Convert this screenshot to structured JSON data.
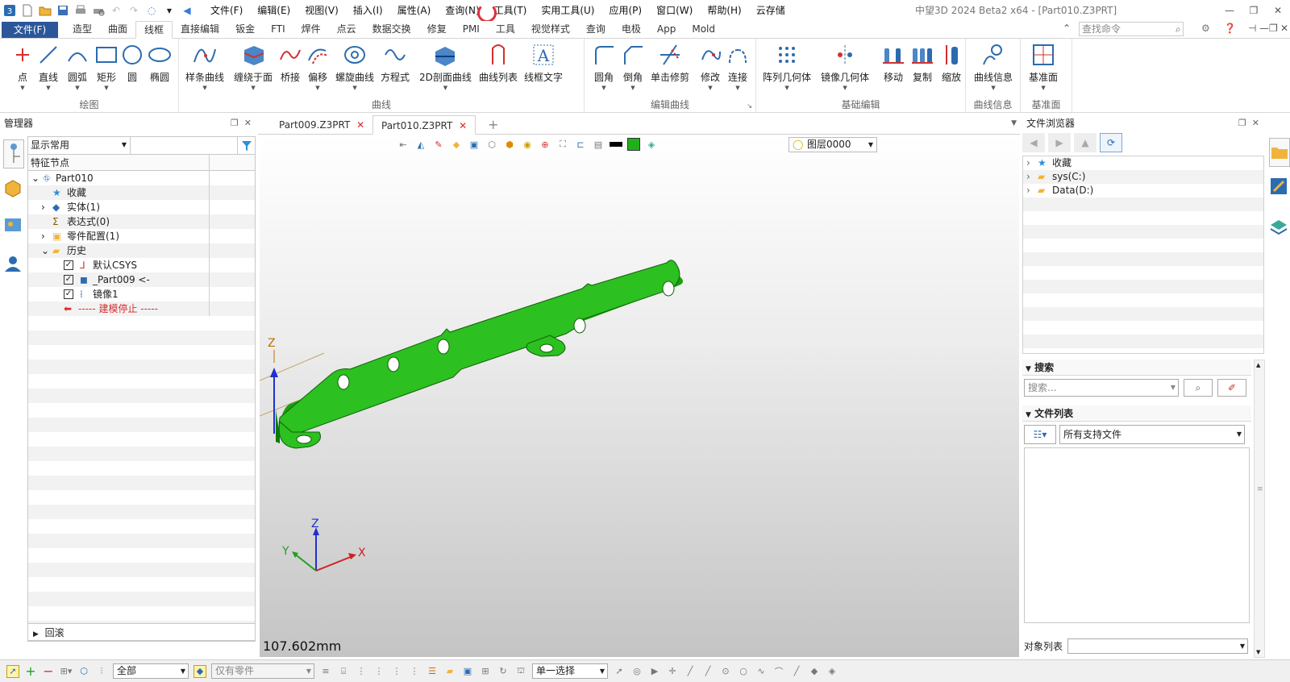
{
  "menubar": {
    "items": [
      "文件(F)",
      "编辑(E)",
      "视图(V)",
      "插入(I)",
      "属性(A)",
      "查询(N)",
      "工具(T)",
      "实用工具(U)",
      "应用(P)",
      "窗口(W)",
      "帮助(H)",
      "云存储"
    ]
  },
  "window": {
    "title": "中望3D 2024 Beta2 x64 - [Part010.Z3PRT]"
  },
  "ribbon_tabs": {
    "file": "文件(F)",
    "tabs": [
      "造型",
      "曲面",
      "线框",
      "直接编辑",
      "钣金",
      "FTI",
      "焊件",
      "点云",
      "数据交换",
      "修复",
      "PMI",
      "工具",
      "视觉样式",
      "查询",
      "电极",
      "App",
      "Mold"
    ],
    "active": "线框"
  },
  "command_search": {
    "placeholder": "查找命令"
  },
  "ribbon": {
    "groups": [
      {
        "title": "绘图",
        "buttons": [
          "点",
          "直线",
          "圆弧",
          "矩形",
          "圆",
          "椭圆"
        ]
      },
      {
        "title": "曲线",
        "buttons": [
          "样条曲线",
          "缠绕于面",
          "桥接",
          "偏移",
          "螺旋曲线",
          "方程式",
          "2D剖面曲线",
          "曲线列表",
          "线框文字"
        ]
      },
      {
        "title": "编辑曲线",
        "buttons": [
          "圆角",
          "倒角",
          "单击修剪",
          "修改",
          "连接"
        ]
      },
      {
        "title": "基础编辑",
        "buttons": [
          "阵列几何体",
          "镜像几何体",
          "移动",
          "复制",
          "缩放"
        ]
      },
      {
        "title": "曲线信息",
        "buttons": [
          "曲线信息"
        ]
      },
      {
        "title": "基准面",
        "buttons": [
          "基准面"
        ]
      }
    ]
  },
  "manager": {
    "title": "管理器",
    "filter": "显示常用",
    "column": "特征节点",
    "tree": [
      "Part010",
      "收藏",
      "实体(1)",
      "表达式(0)",
      "零件配置(1)",
      "历史",
      "默认CSYS",
      "_Part009 <-",
      "镜像1",
      "----- 建模停止 -----"
    ],
    "rollback": "回滚"
  },
  "doc_tabs": [
    "Part009.Z3PRT",
    "Part010.Z3PRT"
  ],
  "viewport": {
    "layer": "图层0000",
    "measure": "107.602mm",
    "axis_labels": {
      "x": "X",
      "y": "Y",
      "z": "Z"
    }
  },
  "file_browser": {
    "title": "文件浏览器",
    "items": [
      "收藏",
      "sys(C:)",
      "Data(D:)"
    ],
    "search_title": "搜索",
    "search_placeholder": "搜索...",
    "filelist_title": "文件列表",
    "filelist_filter": "所有支持文件",
    "object_list": "对象列表"
  },
  "statusbar": {
    "filter": "全部",
    "parts": "仅有零件",
    "select_mode": "单一选择"
  },
  "colors": {
    "accent": "#2b579a",
    "part_green": "#22b01a",
    "file_tab": "#2b579a"
  }
}
